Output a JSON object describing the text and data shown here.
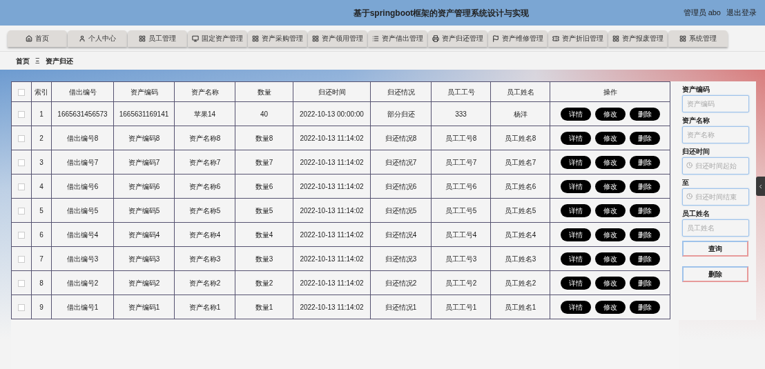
{
  "header": {
    "title": "基于springboot框架的资产管理系统设计与实现",
    "user": "管理员 abo",
    "logout": "退出登录"
  },
  "nav": [
    {
      "label": "首页"
    },
    {
      "label": "个人中心"
    },
    {
      "label": "员工管理"
    },
    {
      "label": "固定资产管理"
    },
    {
      "label": "资产采购管理"
    },
    {
      "label": "资产领用管理"
    },
    {
      "label": "资产借出管理"
    },
    {
      "label": "资产归还管理"
    },
    {
      "label": "资产维修管理"
    },
    {
      "label": "资产折旧管理"
    },
    {
      "label": "资产报废管理"
    },
    {
      "label": "系统管理"
    }
  ],
  "breadcrumb": {
    "home": "首页",
    "separator": "Ξ",
    "current": "资产归还"
  },
  "table": {
    "all_checked": false,
    "columns": [
      "索引",
      "借出编号",
      "资产编码",
      "资产名称",
      "数量",
      "归还时间",
      "归还情况",
      "员工工号",
      "员工姓名",
      "操作"
    ],
    "rows": [
      {
        "checked": false,
        "cells": [
          "1",
          "1665631456573",
          "1665631169141",
          "苹果14",
          "40",
          "2022-10-13 00:00:00",
          "部分归还",
          "333",
          "杨洋"
        ],
        "actions": [
          "详情",
          "修改",
          "删除"
        ]
      },
      {
        "checked": false,
        "cells": [
          "2",
          "借出编号8",
          "资产编码8",
          "资产名称8",
          "数量8",
          "2022-10-13 11:14:02",
          "归还情况8",
          "员工工号8",
          "员工姓名8"
        ],
        "actions": [
          "详情",
          "修改",
          "删除"
        ]
      },
      {
        "checked": false,
        "cells": [
          "3",
          "借出编号7",
          "资产编码7",
          "资产名称7",
          "数量7",
          "2022-10-13 11:14:02",
          "归还情况7",
          "员工工号7",
          "员工姓名7"
        ],
        "actions": [
          "详情",
          "修改",
          "删除"
        ]
      },
      {
        "checked": false,
        "cells": [
          "4",
          "借出编号6",
          "资产编码6",
          "资产名称6",
          "数量6",
          "2022-10-13 11:14:02",
          "归还情况6",
          "员工工号6",
          "员工姓名6"
        ],
        "actions": [
          "详情",
          "修改",
          "删除"
        ]
      },
      {
        "checked": false,
        "cells": [
          "5",
          "借出编号5",
          "资产编码5",
          "资产名称5",
          "数量5",
          "2022-10-13 11:14:02",
          "归还情况5",
          "员工工号5",
          "员工姓名5"
        ],
        "actions": [
          "详情",
          "修改",
          "删除"
        ]
      },
      {
        "checked": false,
        "cells": [
          "6",
          "借出编号4",
          "资产编码4",
          "资产名称4",
          "数量4",
          "2022-10-13 11:14:02",
          "归还情况4",
          "员工工号4",
          "员工姓名4"
        ],
        "actions": [
          "详情",
          "修改",
          "删除"
        ]
      },
      {
        "checked": false,
        "cells": [
          "7",
          "借出编号3",
          "资产编码3",
          "资产名称3",
          "数量3",
          "2022-10-13 11:14:02",
          "归还情况3",
          "员工工号3",
          "员工姓名3"
        ],
        "actions": [
          "详情",
          "修改",
          "删除"
        ]
      },
      {
        "checked": false,
        "cells": [
          "8",
          "借出编号2",
          "资产编码2",
          "资产名称2",
          "数量2",
          "2022-10-13 11:14:02",
          "归还情况2",
          "员工工号2",
          "员工姓名2"
        ],
        "actions": [
          "详情",
          "修改",
          "删除"
        ]
      },
      {
        "checked": false,
        "cells": [
          "9",
          "借出编号1",
          "资产编码1",
          "资产名称1",
          "数量1",
          "2022-10-13 11:14:02",
          "归还情况1",
          "员工工号1",
          "员工姓名1"
        ],
        "actions": [
          "详情",
          "修改",
          "删除"
        ]
      }
    ]
  },
  "filters": [
    {
      "kind": "text",
      "label": "资产编码",
      "placeholder": "资产编码"
    },
    {
      "kind": "text",
      "label": "资产名称",
      "placeholder": "资产名称"
    },
    {
      "kind": "date",
      "label": "归还时间",
      "placeholder": "归还时间起始"
    },
    {
      "kind": "date",
      "label": "至",
      "placeholder": "归还时间结束"
    },
    {
      "kind": "text",
      "label": "员工姓名",
      "placeholder": "员工姓名"
    }
  ],
  "filter_buttons": [
    "查询",
    "删除"
  ]
}
